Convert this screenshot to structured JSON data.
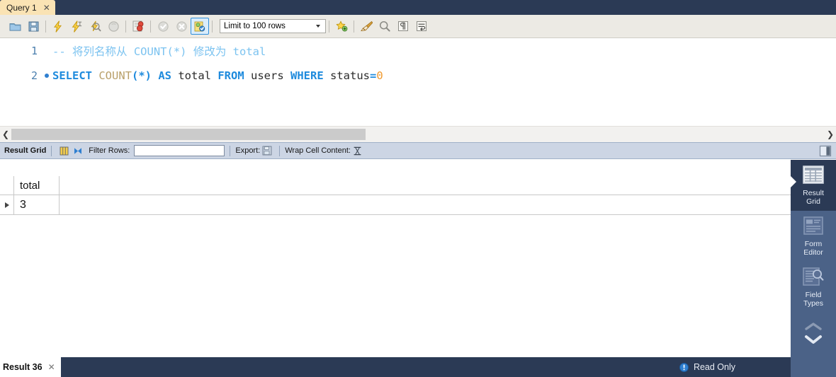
{
  "tab": {
    "label": "Query 1",
    "close": "✕"
  },
  "toolbar": {
    "icons": [
      {
        "name": "open-file-icon",
        "title": "Open SQL Script"
      },
      {
        "name": "save-file-icon",
        "title": "Save SQL Script"
      },
      {
        "name": "execute-icon",
        "title": "Execute"
      },
      {
        "name": "execute-current-icon",
        "title": "Execute Current Statement"
      },
      {
        "name": "explain-icon",
        "title": "Explain"
      },
      {
        "name": "stop-icon",
        "title": "Stop"
      },
      {
        "name": "toggle-stop-on-error-icon",
        "title": "Toggle whether execution should stop on errors"
      },
      {
        "name": "commit-icon",
        "title": "Commit"
      },
      {
        "name": "rollback-icon",
        "title": "Rollback"
      },
      {
        "name": "autocommit-icon",
        "title": "Toggle Auto-Commit"
      },
      {
        "name": "beautify-icon",
        "title": "Beautify SQL"
      },
      {
        "name": "find-icon",
        "title": "Find"
      },
      {
        "name": "invisible-chars-icon",
        "title": "Toggle invisible characters"
      },
      {
        "name": "wrap-lines-icon",
        "title": "Toggle wrapping of long lines"
      }
    ],
    "limit_label": "Limit to 100 rows"
  },
  "editor": {
    "lines": [
      {
        "number": "1",
        "has_marker": false,
        "tokens": [
          {
            "text": "-- ",
            "cls": "cmt"
          },
          {
            "text": "将列名称从 COUNT(*) 修改为 total",
            "cls": "cmt"
          }
        ]
      },
      {
        "number": "2",
        "has_marker": true,
        "tokens": [
          {
            "text": "SELECT ",
            "cls": "kw"
          },
          {
            "text": "COUNT",
            "cls": "fn"
          },
          {
            "text": "(*)",
            "cls": "pn"
          },
          {
            "text": " ",
            "cls": "id"
          },
          {
            "text": "AS",
            "cls": "kw"
          },
          {
            "text": " total ",
            "cls": "id"
          },
          {
            "text": "FROM",
            "cls": "kw"
          },
          {
            "text": " users ",
            "cls": "id"
          },
          {
            "text": "WHERE",
            "cls": "kw"
          },
          {
            "text": " status",
            "cls": "id"
          },
          {
            "text": "=",
            "cls": "kw"
          },
          {
            "text": "0",
            "cls": "num"
          }
        ]
      }
    ]
  },
  "result_toolbar": {
    "title": "Result Grid",
    "filter_label": "Filter Rows:",
    "filter_value": "",
    "filter_placeholder": "",
    "export_label": "Export:",
    "wrap_label": "Wrap Cell Content:",
    "wrap_glyph": "⨿"
  },
  "grid": {
    "columns": [
      "total"
    ],
    "rows": [
      [
        "3"
      ]
    ]
  },
  "sidebar": {
    "items": [
      {
        "label_line1": "Result",
        "label_line2": "Grid",
        "name": "result-grid",
        "active": true
      },
      {
        "label_line1": "Form",
        "label_line2": "Editor",
        "name": "form-editor",
        "active": false
      },
      {
        "label_line1": "Field",
        "label_line2": "Types",
        "name": "field-types",
        "active": false
      }
    ]
  },
  "statusbar": {
    "result_tab": "Result 36",
    "result_tab_close": "✕",
    "read_only": "Read Only"
  }
}
